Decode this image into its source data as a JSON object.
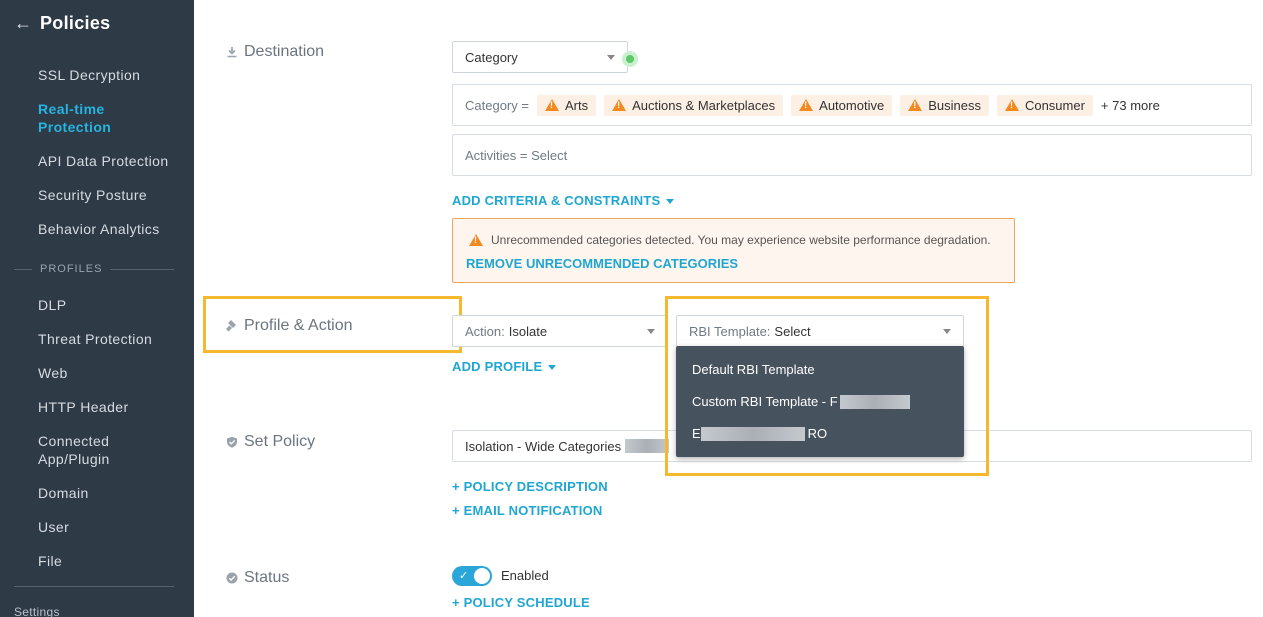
{
  "sidebar": {
    "title": "Policies",
    "items": [
      {
        "label": "SSL Decryption"
      },
      {
        "label": "Real-time Protection"
      },
      {
        "label": "API Data Protection"
      },
      {
        "label": "Security Posture"
      },
      {
        "label": "Behavior Analytics"
      }
    ],
    "section": "PROFILES",
    "profile_items": [
      {
        "label": "DLP"
      },
      {
        "label": "Threat Protection"
      },
      {
        "label": "Web"
      },
      {
        "label": "HTTP Header"
      },
      {
        "label": "Connected App/Plugin"
      },
      {
        "label": "Domain"
      },
      {
        "label": "User"
      },
      {
        "label": "File"
      }
    ],
    "settings": "Settings"
  },
  "destination": {
    "label": "Destination",
    "select_value": "Category",
    "category_prefix": "Category =",
    "chips": [
      "Arts",
      "Auctions & Marketplaces",
      "Automotive",
      "Business",
      "Consumer"
    ],
    "more": "+ 73 more",
    "activities": "Activities = Select",
    "add_criteria": "ADD CRITERIA & CONSTRAINTS",
    "warning": "Unrecommended categories detected. You may experience website performance degradation.",
    "remove": "REMOVE UNRECOMMENDED CATEGORIES"
  },
  "profile_action": {
    "label": "Profile & Action",
    "action_label": "Action:",
    "action_value": "Isolate",
    "rbi_label": "RBI Template:",
    "rbi_value": "Select",
    "add_profile": "ADD PROFILE",
    "options": [
      "Default RBI Template",
      "Custom RBI Template - F",
      "E",
      "RO"
    ]
  },
  "set_policy": {
    "label": "Set Policy",
    "name": "Isolation - Wide Categories",
    "policy_description": "+ POLICY DESCRIPTION",
    "email_notification": "+ EMAIL NOTIFICATION"
  },
  "status": {
    "label": "Status",
    "toggle": "Enabled",
    "toggle_on": true,
    "schedule": "+ POLICY SCHEDULE"
  },
  "colors": {
    "sidebar_bg": "#2e3a46",
    "accent": "#1fa6d2",
    "active": "#25b4e0",
    "warning": "#f28a20",
    "highlight": "#f5b82e"
  }
}
